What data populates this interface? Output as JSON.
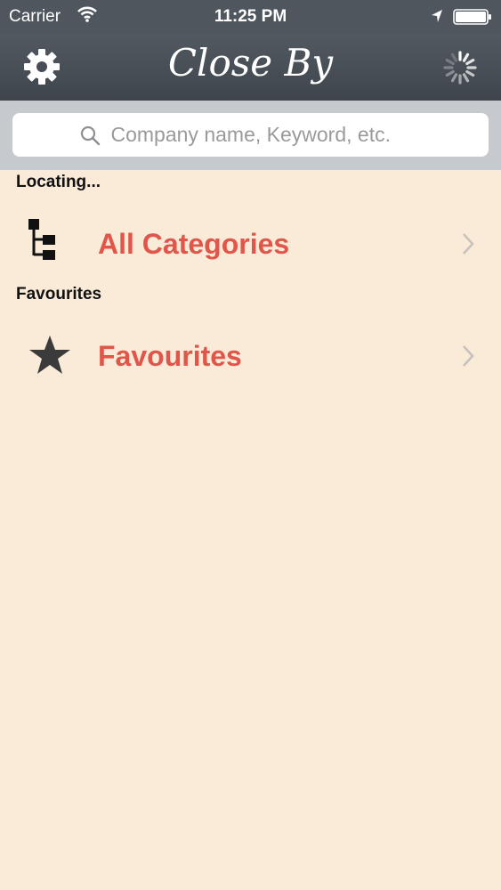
{
  "status_bar": {
    "carrier": "Carrier",
    "time": "11:25 PM",
    "icons": [
      "wifi-icon",
      "location-arrow-icon",
      "battery-icon"
    ]
  },
  "nav_bar": {
    "title": "Close By",
    "left_icon": "gear-icon",
    "right_icon": "activity-spinner-icon"
  },
  "search": {
    "placeholder": "Company name, Keyword, etc."
  },
  "sections": [
    {
      "header": "Locating...",
      "item": {
        "label": "All Categories",
        "icon": "category-tree-icon"
      }
    },
    {
      "header": "Favourites",
      "item": {
        "label": "Favourites",
        "icon": "star-icon"
      }
    }
  ],
  "colors": {
    "background": "#faebd9",
    "nav_bar": "#4a5057",
    "accent_text": "#e0564a",
    "search_bar_bg": "#c6c9cd"
  }
}
